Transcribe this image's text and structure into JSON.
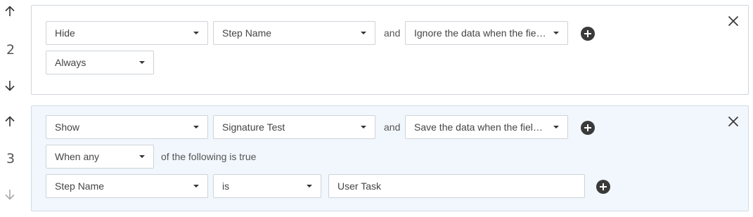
{
  "rules": [
    {
      "step": "2",
      "action": "Hide",
      "target": "Step Name",
      "connector": "and",
      "data_option": "Ignore the data when the field is hidden",
      "condition_mode": "Always"
    },
    {
      "step": "3",
      "action": "Show",
      "target": "Signature Test",
      "connector": "and",
      "data_option": "Save the data when the field is hidden",
      "condition_mode": "When any",
      "condition_suffix": "of the following is true",
      "condition": {
        "field": "Step Name",
        "operator": "is",
        "value": "User Task"
      }
    }
  ],
  "colors": {
    "card_border": "#cfd6dd",
    "card_active_bg": "#f1f7fc",
    "add_button": "#3a3a3a"
  }
}
